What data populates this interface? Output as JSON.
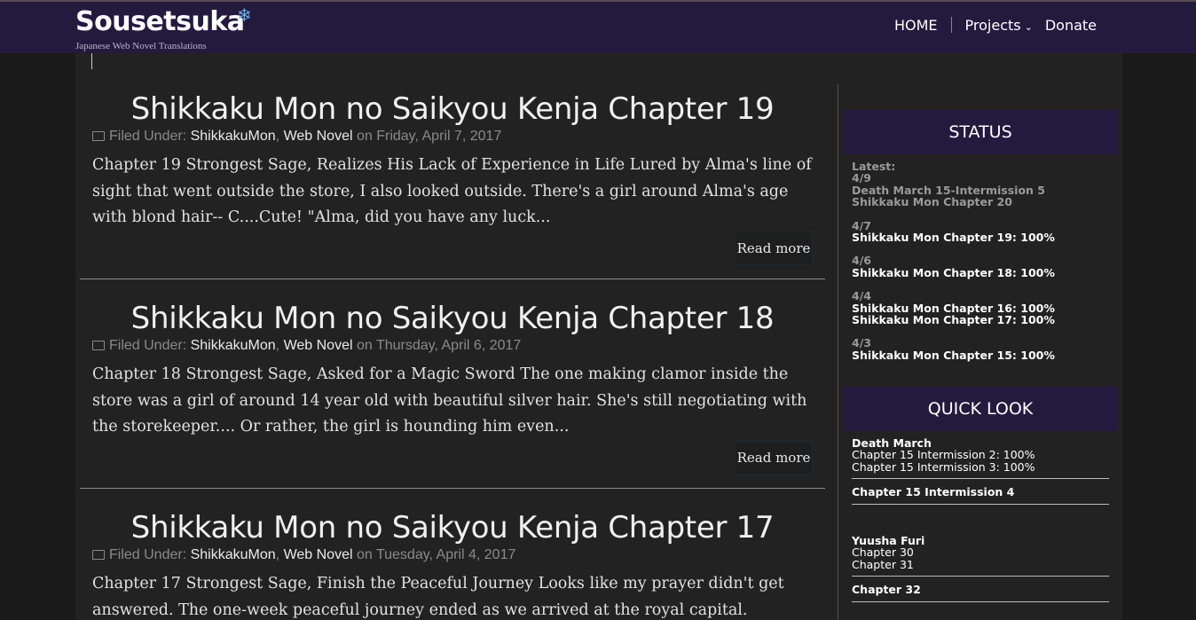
{
  "site": {
    "title": "Sousetsuka",
    "snowflake": "❄",
    "tagline": "Japanese Web Novel Translations"
  },
  "nav": {
    "home": "HOME",
    "projects": "Projects",
    "projects_chevron": "⌄",
    "donate": "Donate"
  },
  "posts": [
    {
      "title": "Shikkaku Mon no Saikyou Kenja Chapter 19",
      "filed_label": "Filed Under:",
      "cat1": "ShikkakuMon",
      "sep": ",",
      "cat2": "Web Novel",
      "date": "on Friday, April 7, 2017",
      "excerpt": "Chapter 19 Strongest Sage, Realizes His Lack of Experience in Life   Lured by Alma's line of sight that went outside the store, I also looked outside. There's a girl around Alma's age with blond hair-- C....Cute! \"Alma, did you have any luck...",
      "read_more": "Read more"
    },
    {
      "title": "Shikkaku Mon no Saikyou Kenja Chapter 18",
      "filed_label": "Filed Under:",
      "cat1": "ShikkakuMon",
      "sep": ",",
      "cat2": "Web Novel",
      "date": "on Thursday, April 6, 2017",
      "excerpt": "Chapter 18 Strongest Sage, Asked for a Magic Sword   The one making clamor inside the store was a girl of around 14 year old with beautiful silver hair. She's still negotiating with the storekeeper.... Or rather, the girl is hounding him even...",
      "read_more": "Read more"
    },
    {
      "title": "Shikkaku Mon no Saikyou Kenja Chapter 17",
      "filed_label": "Filed Under:",
      "cat1": "ShikkakuMon",
      "sep": ",",
      "cat2": "Web Novel",
      "date": "on Tuesday, April 4, 2017",
      "excerpt": "Chapter 17 Strongest Sage, Finish the Peaceful Journey   Looks like my prayer didn't get answered. The one-week peaceful journey ended as we arrived at the royal capital."
    }
  ],
  "status": {
    "heading": "STATUS",
    "latest_label": "Latest:",
    "latest_date": "4/9",
    "latest_items": [
      "Death March 15-Intermission 5",
      "Shikkaku Mon Chapter 20"
    ],
    "groups": [
      {
        "date": "4/7",
        "items": [
          "Shikkaku Mon Chapter 19: 100%"
        ]
      },
      {
        "date": "4/6",
        "items": [
          "Shikkaku Mon Chapter 18: 100%"
        ]
      },
      {
        "date": "4/4",
        "items": [
          "Shikkaku Mon Chapter 16: 100%",
          "Shikkaku Mon Chapter 17: 100%"
        ]
      },
      {
        "date": "4/3",
        "items": [
          "Shikkaku Mon Chapter 15: 100%"
        ]
      }
    ]
  },
  "quick_look": {
    "heading": "QUICK LOOK",
    "dm_title": "Death March",
    "dm_lines": [
      "Chapter 15 Intermission 2: 100%",
      "Chapter 15 Intermission 3: 100%"
    ],
    "dm_next": "Chapter 15 Intermission 4",
    "yf_title": "Yuusha Furi",
    "yf_lines": [
      "Chapter 30",
      "Chapter 31"
    ],
    "yf_next": "Chapter 32"
  }
}
